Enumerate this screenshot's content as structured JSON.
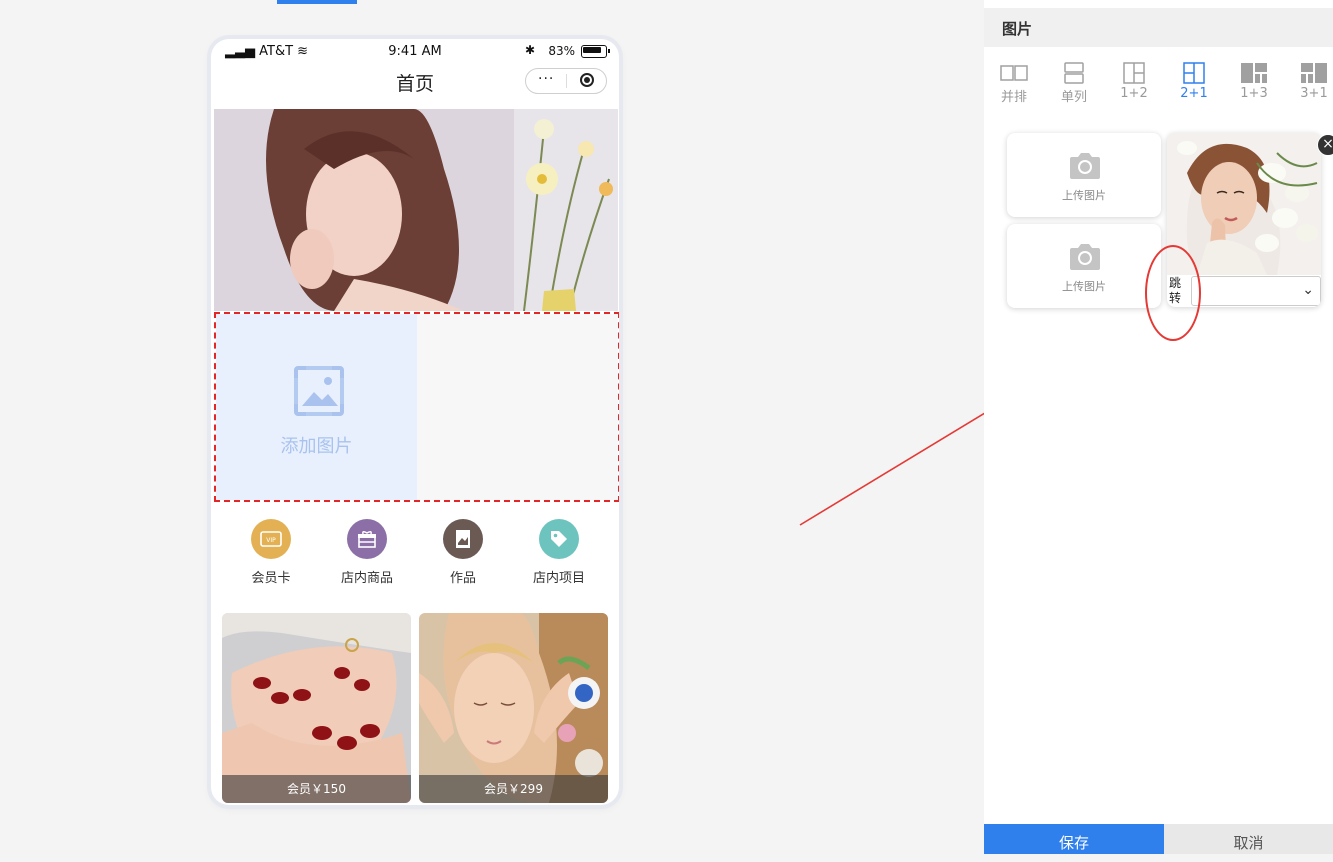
{
  "status_bar": {
    "carrier": "AT&T",
    "time": "9:41 AM",
    "battery": "83%"
  },
  "nav": {
    "title": "首页"
  },
  "grid": {
    "add_image_label": "添加图片"
  },
  "quick_nav": [
    {
      "label": "会员卡",
      "color": "#e3b153"
    },
    {
      "label": "店内商品",
      "color": "#8c6fa6"
    },
    {
      "label": "作品",
      "color": "#6b5a54"
    },
    {
      "label": "店内项目",
      "color": "#6dc3be"
    }
  ],
  "products": [
    {
      "price": "会员￥150"
    },
    {
      "price": "会员￥299"
    }
  ],
  "panel": {
    "title": "图片",
    "layouts": [
      {
        "label": "并排",
        "active": false
      },
      {
        "label": "单列",
        "active": false
      },
      {
        "label": "1+2",
        "active": false
      },
      {
        "label": "2+1",
        "active": true
      },
      {
        "label": "1+3",
        "active": false
      },
      {
        "label": "3+1",
        "active": false
      }
    ],
    "upload_label": "上传图片",
    "jump_label": "跳转",
    "close": "×",
    "save": "保存",
    "cancel": "取消"
  },
  "colors": {
    "accent": "#2f80ed",
    "annotation": "#e53935",
    "dashed_border": "#e32626"
  }
}
